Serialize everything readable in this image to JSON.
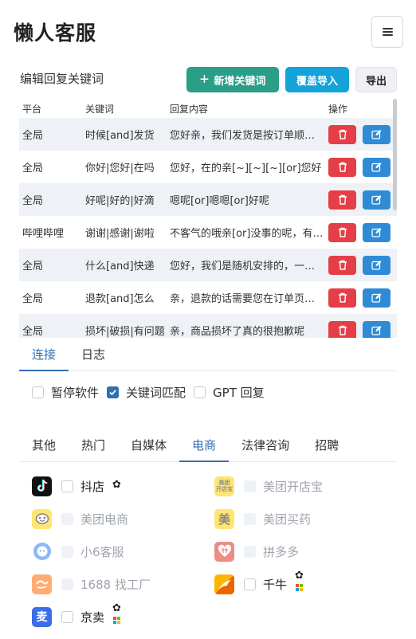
{
  "app": {
    "title": "懒人客服"
  },
  "keywords": {
    "title": "编辑回复关键词",
    "add_label": "新增关键词",
    "import_label": "覆盖导入",
    "export_label": "导出",
    "columns": [
      "平台",
      "关键词",
      "回复内容",
      "操作"
    ],
    "rows": [
      {
        "platform": "全局",
        "keyword": "时候[and]发货",
        "reply": "您好亲，我们发货是按订单顺序发货的"
      },
      {
        "platform": "全局",
        "keyword": "你好|您好|在吗",
        "reply": "您好，在的亲[~][~][~][or]您好"
      },
      {
        "platform": "全局",
        "keyword": "好呢|好的|好滴",
        "reply": "嗯呢[or]嗯嗯[or]好呢"
      },
      {
        "platform": "哔哩哔哩",
        "keyword": "谢谢|感谢|谢啦",
        "reply": "不客气的哦亲[or]没事的呢，有问题随时联系"
      },
      {
        "platform": "全局",
        "keyword": "什么[and]快递",
        "reply": "您好，我们是随机安排的，一般是中通"
      },
      {
        "platform": "全局",
        "keyword": "退款[and]怎么",
        "reply": "亲，退款的话需要您在订单页面申请"
      },
      {
        "platform": "全局",
        "keyword": "损坏|破损|有问题",
        "reply": "亲，商品损坏了真的很抱歉呢"
      }
    ]
  },
  "main_tabs": [
    "连接",
    "日志"
  ],
  "options": [
    {
      "label": "暂停软件",
      "checked": false
    },
    {
      "label": "关键词匹配",
      "checked": true
    },
    {
      "label": "GPT 回复",
      "checked": false
    }
  ],
  "category_tabs": [
    "其他",
    "热门",
    "自媒体",
    "电商",
    "法律咨询",
    "招聘"
  ],
  "platforms": [
    {
      "name": "抖店",
      "icon": "douyin-icon",
      "enabled": true,
      "gear": true,
      "windows": false
    },
    {
      "name": "美团开店宝",
      "icon": "meituan-kaidianbao-icon",
      "enabled": false,
      "gear": false,
      "windows": false
    },
    {
      "name": "美团电商",
      "icon": "meituan-dianshang-icon",
      "enabled": false,
      "gear": false,
      "windows": false
    },
    {
      "name": "美团买药",
      "icon": "meituan-maiyao-icon",
      "enabled": false,
      "gear": false,
      "windows": false
    },
    {
      "name": "小6客服",
      "icon": "xiao6-icon",
      "enabled": false,
      "gear": false,
      "windows": false
    },
    {
      "name": "拼多多",
      "icon": "pinduoduo-icon",
      "enabled": false,
      "gear": false,
      "windows": false
    },
    {
      "name": "1688 找工厂",
      "icon": "alibaba-1688-icon",
      "enabled": false,
      "gear": false,
      "windows": false
    },
    {
      "name": "千牛",
      "icon": "qianniu-icon",
      "enabled": true,
      "gear": true,
      "windows": true
    },
    {
      "name": "京卖",
      "icon": "jingmai-icon",
      "enabled": true,
      "gear": true,
      "windows": true
    }
  ],
  "colors": {
    "accent": "#2f6fb5",
    "add": "#2b9e87",
    "import": "#13a3d8",
    "delete": "#e43f47",
    "edit": "#2f8bd6"
  }
}
